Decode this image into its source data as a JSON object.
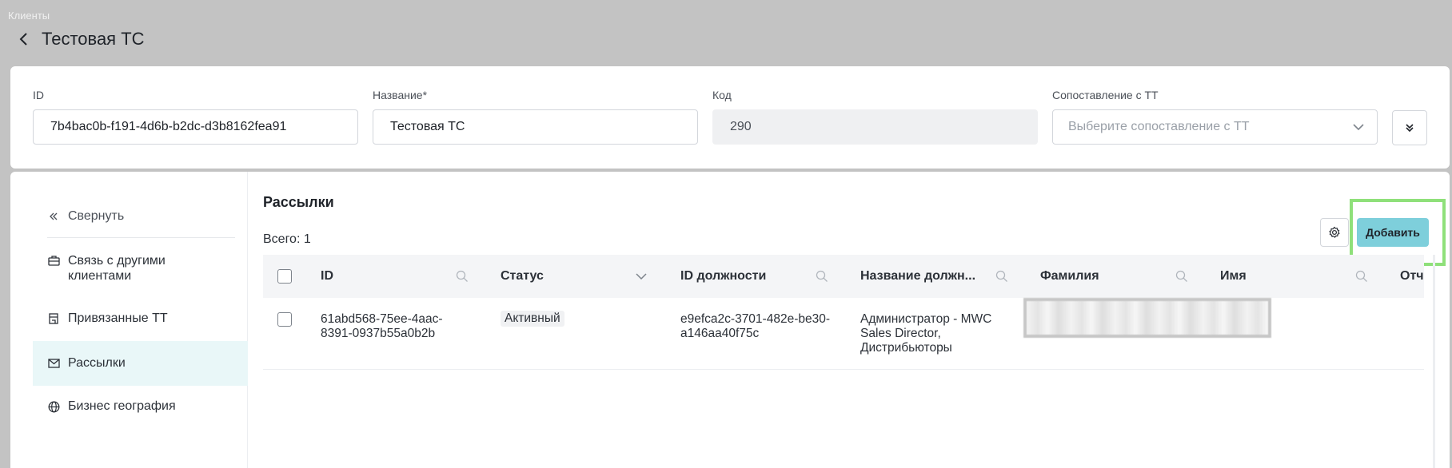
{
  "breadcrumb": "Клиенты",
  "header": {
    "title": "Тестовая ТС"
  },
  "form": {
    "id": {
      "label": "ID",
      "value": "7b4bac0b-f191-4d6b-b2dc-d3b8162fea91"
    },
    "name": {
      "label": "Название*",
      "value": "Тестовая ТС"
    },
    "code": {
      "label": "Код",
      "value": "290"
    },
    "mapping": {
      "label": "Сопоставление с ТТ",
      "placeholder": "Выберите сопоставление с ТТ"
    }
  },
  "sidebar": {
    "collapse": "Свернуть",
    "items": [
      {
        "label": "Связь с другими клиентами",
        "icon": "briefcase-icon"
      },
      {
        "label": "Привязанные ТТ",
        "icon": "store-icon"
      },
      {
        "label": "Рассылки",
        "icon": "mail-icon",
        "active": true
      },
      {
        "label": "Бизнес география",
        "icon": "globe-icon"
      }
    ]
  },
  "section": {
    "title": "Рассылки",
    "total": "Всего: 1",
    "add_label": "Добавить"
  },
  "table": {
    "columns": [
      "ID",
      "Статус",
      "ID должности",
      "Название должн...",
      "Фамилия",
      "Имя",
      "Отч"
    ],
    "rows": [
      {
        "id": "61abd568-75ee-4aac-8391-0937b55a0b2b",
        "status": "Активный",
        "position_id": "e9efca2c-3701-482e-be30-a146aa40f75c",
        "position_name": "Администратор - MWC Sales Director, Дистрибьюторы"
      }
    ]
  },
  "colors": {
    "accent": "#7ecfdb",
    "active_bg": "#e9f7f8",
    "highlight": "#8fe07a"
  }
}
